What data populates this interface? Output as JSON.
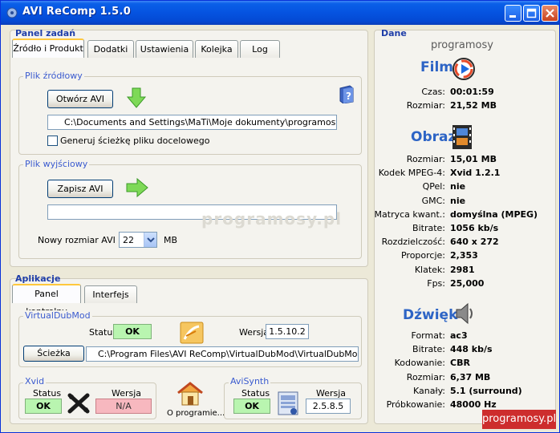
{
  "window": {
    "title": "AVI ReComp  1.5.0"
  },
  "panel_zadan": {
    "title": "Panel zadań",
    "tabs": [
      "Źródło i Produkt",
      "Dodatki",
      "Ustawienia",
      "Kolejka",
      "Log"
    ],
    "source": {
      "label": "Plik źródłowy",
      "open_button": "Otwórz AVI",
      "path": "C:\\Documents and Settings\\MaTi\\Moje dokumenty\\programosy.avi",
      "checkbox_label": "Generuj ścieżkę pliku docelowego"
    },
    "output": {
      "label": "Plik wyjściowy",
      "save_button": "Zapisz AVI",
      "path": "",
      "size_label": "Nowy rozmiar AVI =",
      "size_value": "22",
      "size_unit": "MB"
    }
  },
  "aplikacje": {
    "title": "Aplikacje",
    "tabs": [
      "Panel kontrolny",
      "Interfejs"
    ],
    "virtualdubmod": {
      "label": "VirtualDubMod",
      "status_label": "Status",
      "status_value": "OK",
      "version_label": "Wersja",
      "version_value": "1.5.10.2",
      "path_button": "Ścieżka",
      "path": "C:\\Program Files\\AVI ReComp\\VirtualDubMod\\VirtualDubMod.exe"
    },
    "xvid": {
      "label": "Xvid",
      "status_label": "Status",
      "status_value": "OK",
      "version_label": "Wersja",
      "version_value": "N/A"
    },
    "about": {
      "label": "O programie..."
    },
    "avisynth": {
      "label": "AviSynth",
      "status_label": "Status",
      "status_value": "OK",
      "version_label": "Wersja",
      "version_value": "2.5.8.5"
    }
  },
  "dane": {
    "title": "Dane",
    "filename": "programosy",
    "film": {
      "heading": "Film",
      "rows": [
        {
          "label": "Czas:",
          "value": "00:01:59"
        },
        {
          "label": "Rozmiar:",
          "value": "21,52 MB"
        }
      ]
    },
    "obraz": {
      "heading": "Obraz",
      "rows": [
        {
          "label": "Rozmiar:",
          "value": "15,01 MB"
        },
        {
          "label": "Kodek MPEG-4:",
          "value": "Xvid 1.2.1"
        },
        {
          "label": "QPel:",
          "value": "nie"
        },
        {
          "label": "GMC:",
          "value": "nie"
        },
        {
          "label": "Matryca kwant.:",
          "value": "domyślna (MPEG)"
        },
        {
          "label": "Bitrate:",
          "value": "1056 kb/s"
        },
        {
          "label": "Rozdzielczość:",
          "value": "640 x 272"
        },
        {
          "label": "Proporcje:",
          "value": "2,353"
        },
        {
          "label": "Klatek:",
          "value": "2981"
        },
        {
          "label": "Fps:",
          "value": "25,000"
        }
      ]
    },
    "dzwiek": {
      "heading": "Dźwięk",
      "rows": [
        {
          "label": "Format:",
          "value": "ac3"
        },
        {
          "label": "Bitrate:",
          "value": "448 kb/s"
        },
        {
          "label": "Kodowanie:",
          "value": "CBR"
        },
        {
          "label": "Rozmiar:",
          "value": "6,37 MB"
        },
        {
          "label": "Kanały:",
          "value": "5.1 (surround)"
        },
        {
          "label": "Próbkowanie:",
          "value": "48000 Hz"
        }
      ]
    }
  },
  "watermark": "programosy.pl",
  "badge": "programosy.pl",
  "colors": {
    "titlebar": "#0553e0",
    "ok": "#b9f5b0",
    "na": "#f7b8bf",
    "heading": "#2d64c5"
  }
}
